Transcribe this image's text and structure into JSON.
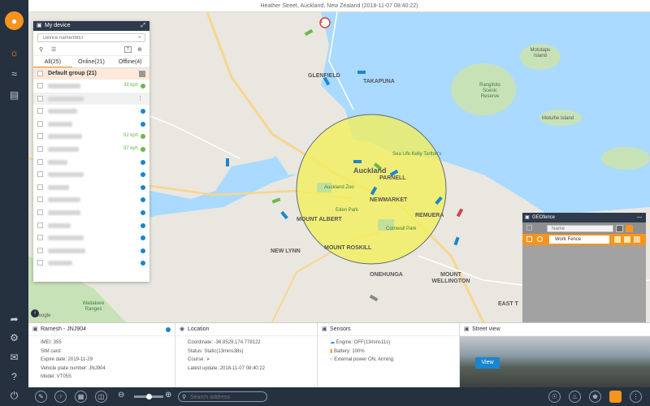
{
  "address_bar": "Heather Street, Auckland, New Zealand (2018-11-07 08:40:22)",
  "map": {
    "labels": {
      "glenfield": "GLENFIELD",
      "takapuna": "TAKAPUNA",
      "auckland": "Auckland",
      "parnell": "PARNELL",
      "newmarket": "NEWMARKET",
      "remuera": "REMUERA",
      "mount_albert": "MOUNT ALBERT",
      "mount_roskill": "MOUNT ROSKILL",
      "new_lynn": "NEW LYNN",
      "onehunga": "ONEHUNGA",
      "mount_wellington": "MOUNT WELLINGTON",
      "east_t": "EAST T",
      "zoo": "Auckland Zoo",
      "eden_park": "Eden Park",
      "cornwall_park": "Cornwall Park",
      "sea_life": "Sea Life Kelly Tarlton's",
      "rangitoto": "Rangitoto Scenic Reserve",
      "motutapu": "Motutapu Island",
      "motuihe": "Motuihe Island",
      "waitakere": "Waitakere Ranges",
      "google": "Google"
    },
    "marker_label": "1"
  },
  "device_panel": {
    "title": "My device",
    "search_placeholder": "Device name/IMEI",
    "tabs": [
      {
        "label": "All(25)"
      },
      {
        "label": "Online(21)"
      },
      {
        "label": "Offline(4)"
      }
    ],
    "tool_t": "T",
    "group": "Default group (21)",
    "devices": [
      {
        "speed": "38 kph",
        "status_color": "#6ab94a",
        "name_width": 40
      },
      {
        "speed": "",
        "status_color": "",
        "name_width": 44,
        "selected": true
      },
      {
        "speed": "",
        "status_color": "#1a86d0",
        "name_width": 36
      },
      {
        "speed": "",
        "status_color": "#1a86d0",
        "name_width": 30
      },
      {
        "speed": "82 kph",
        "status_color": "#6ab94a",
        "name_width": 42
      },
      {
        "speed": "97 kph",
        "status_color": "#6ab94a",
        "name_width": 38
      },
      {
        "speed": "",
        "status_color": "#1a86d0",
        "name_width": 24
      },
      {
        "speed": "",
        "status_color": "#1a86d0",
        "name_width": 44
      },
      {
        "speed": "",
        "status_color": "#1a86d0",
        "name_width": 26
      },
      {
        "speed": "",
        "status_color": "#1a86d0",
        "name_width": 40
      },
      {
        "speed": "",
        "status_color": "#1a86d0",
        "name_width": 40
      },
      {
        "speed": "",
        "status_color": "#1a86d0",
        "name_width": 28
      },
      {
        "speed": "",
        "status_color": "#1a86d0",
        "name_width": 44
      },
      {
        "speed": "",
        "status_color": "#1a86d0",
        "name_width": 46
      },
      {
        "speed": "",
        "status_color": "#1a86d0",
        "name_width": 30
      }
    ]
  },
  "geofence": {
    "title": "GEOfence",
    "search_placeholder": "Name",
    "fence_name": "Work Fence"
  },
  "info": {
    "vehicle": {
      "title": "Ramesh - JNJ904",
      "imei_label": "IMEI: 355",
      "sim_label": "SIM card:",
      "expire": "Expire date: 2019-11-29",
      "plate": "Vehicle plate number: JNJ904",
      "model": "Model: VT05S"
    },
    "location": {
      "title": "Location",
      "coordinate": "Coordinate: -36.8529,174.778122",
      "status": "Status: Static(13mins38s)",
      "course": "Course:",
      "latest_update": "Latest update: 2018-11-07 08:40:22"
    },
    "sensors": {
      "title": "Sensors",
      "engine": "Engine: OFF(13mins11s)",
      "battery": "Battery: 100%",
      "power": "External power ON, Arming:"
    },
    "street_view": {
      "title": "Street view",
      "view_button": "View"
    }
  },
  "toolbar": {
    "search_placeholder": "Search address"
  },
  "colors": {
    "accent": "#f7941d",
    "sidebar": "#263140",
    "online": "#6ab94a",
    "offline": "#1a86d0",
    "geofence_fill": "#f4f05a"
  }
}
